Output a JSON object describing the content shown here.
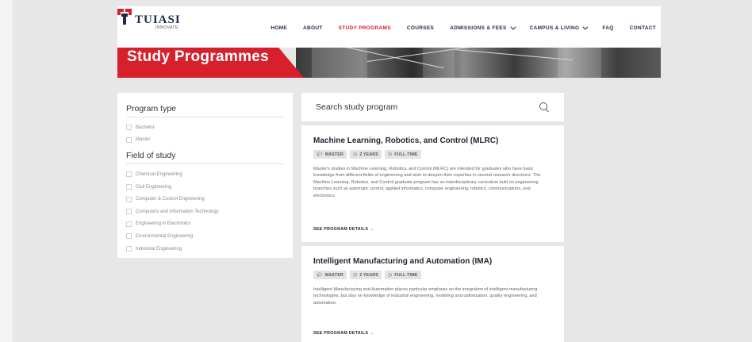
{
  "logo": {
    "name": "TUIASI",
    "tagline": "INNOVATE"
  },
  "nav": [
    {
      "label": "HOME",
      "dropdown": false,
      "active": false
    },
    {
      "label": "ABOUT",
      "dropdown": false,
      "active": false
    },
    {
      "label": "STUDY PROGRAMS",
      "dropdown": false,
      "active": true
    },
    {
      "label": "COURSES",
      "dropdown": false,
      "active": false
    },
    {
      "label": "ADMISSIONS & FEES",
      "dropdown": true,
      "active": false
    },
    {
      "label": "CAMPUS & LIVING",
      "dropdown": true,
      "active": false
    },
    {
      "label": "FAQ",
      "dropdown": false,
      "active": false
    },
    {
      "label": "CONTACT",
      "dropdown": false,
      "active": false
    }
  ],
  "hero": {
    "title": "Study Programmes"
  },
  "filters": {
    "program_type": {
      "heading": "Program type",
      "options": [
        "Bachelor",
        "Master"
      ]
    },
    "field_of_study": {
      "heading": "Field of study",
      "options": [
        "Chemical Engineering",
        "Civil Engineering",
        "Computer & Control Engineering",
        "Computers and Information Technology",
        "Engineering in Electronics",
        "Environmental Engineering",
        "Industrial Engineering"
      ]
    }
  },
  "search": {
    "placeholder": "Search study program",
    "value": ""
  },
  "programs": [
    {
      "title": "Machine Learning, Robotics, and Control (MLRC)",
      "badges": {
        "level": "MASTER",
        "duration": "2 YEARS",
        "mode": "FULL-TIME"
      },
      "description": "Master's studies in Machine Learning, Robotics, and Control (MLRC) are intended for graduates who have basic knowledge from different fields of engineering and wish to deepen their expertise in several research directions. The Machine Learning, Robotics, and Control graduate program has an interdisciplinary curriculum built on engineering branches such as automatic control, applied informatics, computer engineering, robotics, communications, and electronics.",
      "link": "SEE PROGRAM DETAILS →"
    },
    {
      "title": "Intelligent Manufacturing and Automation (IMA)",
      "badges": {
        "level": "MASTER",
        "duration": "2 YEARS",
        "mode": "FULL-TIME"
      },
      "description": "Intelligent Manufacturing and Automation places particular emphasis on the integration of intelligent manufacturing technologies, but also on knowledge of industrial engineering, modeling and optimization, quality engineering, and automation.",
      "link": "SEE PROGRAM DETAILS →"
    }
  ],
  "icons": {
    "level": "graduation-cap-icon",
    "duration": "clock-icon",
    "mode": "clock-icon",
    "search": "search-icon",
    "dropdown": "chevron-down-icon"
  },
  "colors": {
    "accent": "#d6202b",
    "navy": "#1e2a4a",
    "background": "#e7e7e7"
  }
}
